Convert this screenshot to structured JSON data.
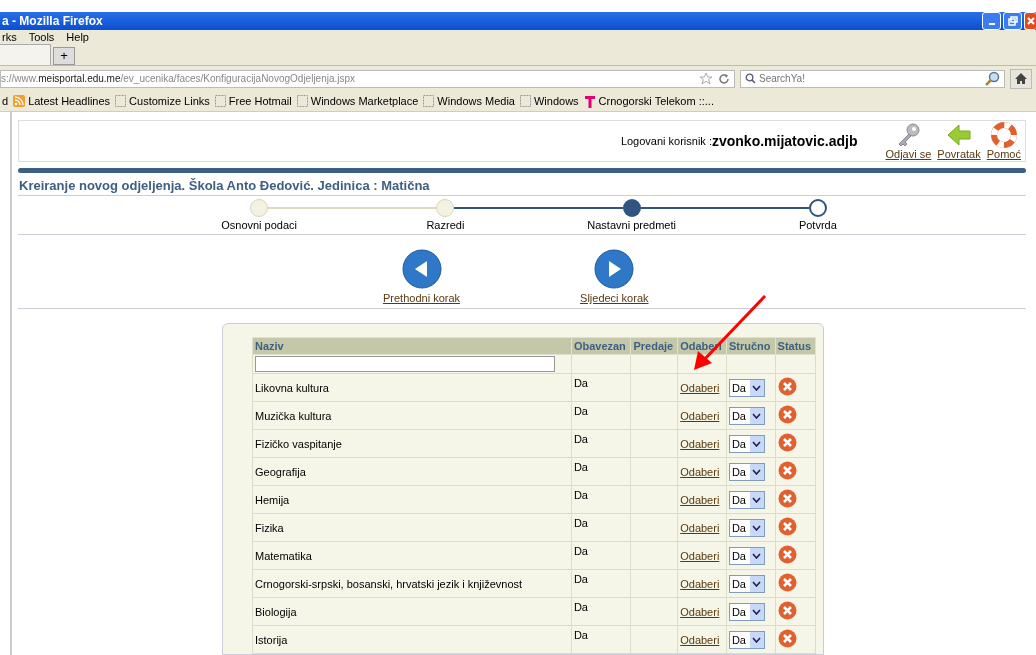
{
  "window": {
    "title": "a - Mozilla Firefox"
  },
  "menu": [
    "rks",
    "Tools",
    "Help"
  ],
  "tabs": [
    {
      "label": "+",
      "kind": "new"
    }
  ],
  "address": {
    "url": "s://www.**meisportal.edu.me**/ev_ucenika/faces/KonfiguracijaNovogOdjeljenja.jspx"
  },
  "search": {
    "placeholder": "SearchYa!"
  },
  "bookmarks": [
    {
      "label": "d",
      "kind": "plain"
    },
    {
      "label": "Latest Headlines",
      "kind": "rss"
    },
    {
      "label": "Customize Links",
      "kind": "page"
    },
    {
      "label": "Free Hotmail",
      "kind": "page"
    },
    {
      "label": "Windows Marketplace",
      "kind": "page"
    },
    {
      "label": "Windows Media",
      "kind": "page"
    },
    {
      "label": "Windows",
      "kind": "page"
    },
    {
      "label": "Crnogorski Telekom ::...",
      "kind": "telekom"
    }
  ],
  "header": {
    "user_label": "Logovani korisnik :",
    "user": "zvonko.mijatovic.adjb",
    "actions": [
      {
        "label": "Odjavi se",
        "kind": "key"
      },
      {
        "label": "Povratak",
        "kind": "back"
      },
      {
        "label": "Pomoć",
        "kind": "help"
      }
    ]
  },
  "page_title": "Kreiranje novog odjeljenja. Škola Anto Đedović. Jedinica : Matična",
  "steps": [
    {
      "label": "Osnovni podaci",
      "completed": true,
      "selected": false
    },
    {
      "label": "Razredi",
      "completed": true,
      "selected": false
    },
    {
      "label": "Nastavni predmeti",
      "completed": false,
      "selected": true
    },
    {
      "label": "Potvrda",
      "completed": false,
      "selected": false
    }
  ],
  "nav": [
    {
      "label": "Prethodni korak",
      "kind": "prev"
    },
    {
      "label": "Sljedeci korak",
      "kind": "next"
    }
  ],
  "table": {
    "columns": [
      "Naziv",
      "Obavezan",
      "Predaje",
      "Odaberi",
      "Stručno",
      "Status"
    ],
    "rows": [
      {
        "naziv": "Likovna kultura",
        "obavezan": "Da",
        "odaberi": "Odaberi",
        "strucno": "Da"
      },
      {
        "naziv": "Muzička kultura",
        "obavezan": "Da",
        "odaberi": "Odaberi",
        "strucno": "Da"
      },
      {
        "naziv": "Fizičko vaspitanje",
        "obavezan": "Da",
        "odaberi": "Odaberi",
        "strucno": "Da"
      },
      {
        "naziv": "Geografija",
        "obavezan": "Da",
        "odaberi": "Odaberi",
        "strucno": "Da"
      },
      {
        "naziv": "Hemija",
        "obavezan": "Da",
        "odaberi": "Odaberi",
        "strucno": "Da"
      },
      {
        "naziv": "Fizika",
        "obavezan": "Da",
        "odaberi": "Odaberi",
        "strucno": "Da"
      },
      {
        "naziv": "Matematika",
        "obavezan": "Da",
        "odaberi": "Odaberi",
        "strucno": "Da"
      },
      {
        "naziv": "Crnogorski-srpski, bosanski, hrvatski jezik i književnost",
        "obavezan": "Da",
        "odaberi": "Odaberi",
        "strucno": "Da"
      },
      {
        "naziv": "Biologija",
        "obavezan": "Da",
        "odaberi": "Odaberi",
        "strucno": "Da"
      },
      {
        "naziv": "Istorija",
        "obavezan": "Da",
        "odaberi": "Odaberi",
        "strucno": "Da"
      }
    ]
  }
}
